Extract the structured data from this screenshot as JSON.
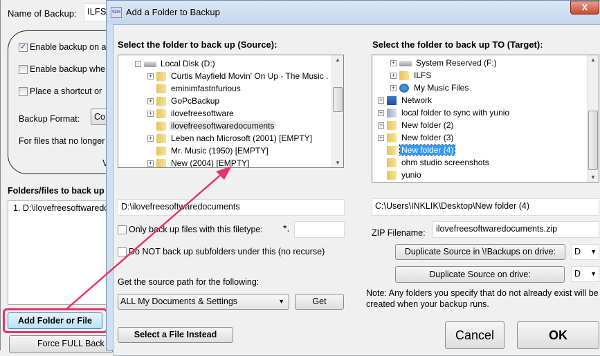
{
  "main_window": {
    "name_label": "Name of Backup:",
    "name_value": "ILFS",
    "options": [
      {
        "label": "Enable backup on a",
        "checked": true
      },
      {
        "label": "Enable backup whe",
        "checked": false
      },
      {
        "label": "Place a shortcut or",
        "checked": false
      }
    ],
    "backup_format_label": "Backup Format:",
    "backup_format_value": "Co",
    "no_longer_label": "For files that no longer",
    "v_label": "V",
    "folders_heading": "Folders/files to back up",
    "folders": [
      "1. D:\\ilovefreesoftwaredo"
    ],
    "add_button": "Add Folder or File",
    "force_button": "Force FULL Back",
    "highlight_color": "#e8336a"
  },
  "dialog": {
    "title": "Add a Folder to Backup",
    "title_icon": "sds-app-icon",
    "close_label": "X",
    "source_heading": "Select the folder to back up (Source):",
    "target_heading": "Select the folder to back up TO (Target):",
    "source_tree": [
      {
        "label": "Local Disk (D:)",
        "icon": "drive-icon",
        "expander": "-",
        "level": 0
      },
      {
        "label": "Curtis Mayfield Movin' On Up - The Music .",
        "icon": "folder-icon",
        "expander": "+",
        "level": 1
      },
      {
        "label": "eminimfastnfurious",
        "icon": "folder-icon",
        "expander": "",
        "level": 1
      },
      {
        "label": "GoPcBackup",
        "icon": "folder-icon",
        "expander": "+",
        "level": 1
      },
      {
        "label": "ilovefreesoftware",
        "icon": "folder-icon",
        "expander": "+",
        "level": 1
      },
      {
        "label": "ilovefreesoftwaredocuments",
        "icon": "folder-icon",
        "expander": "",
        "level": 1,
        "selected": true
      },
      {
        "label": "Leben nach Microsoft (2001) [EMPTY]",
        "icon": "folder-icon",
        "expander": "+",
        "level": 1
      },
      {
        "label": "Mr. Music (1950) [EMPTY]",
        "icon": "folder-icon",
        "expander": "",
        "level": 1
      },
      {
        "label": "New (2004) [EMPTY]",
        "icon": "folder-icon",
        "expander": "+",
        "level": 1
      }
    ],
    "target_tree": [
      {
        "label": "System Reserved (F:)",
        "icon": "drive-icon",
        "expander": "+",
        "level": 1
      },
      {
        "label": "ILFS",
        "icon": "folder-icon",
        "expander": "+",
        "level": 1
      },
      {
        "label": "My Music Files",
        "icon": "music-icon",
        "expander": "+",
        "level": 1
      },
      {
        "label": "Network",
        "icon": "network-icon",
        "expander": "+",
        "level": 0
      },
      {
        "label": "local folder to sync with yunio",
        "icon": "library-icon",
        "expander": "+",
        "level": 0
      },
      {
        "label": "New folder (2)",
        "icon": "folder-icon",
        "expander": "+",
        "level": 0
      },
      {
        "label": "New folder (3)",
        "icon": "folder-icon",
        "expander": "+",
        "level": 0
      },
      {
        "label": "New folder (4)",
        "icon": "folder-icon",
        "expander": "",
        "level": 0,
        "selected": true
      },
      {
        "label": "ohm studio screenshots",
        "icon": "folder-icon",
        "expander": "",
        "level": 0
      },
      {
        "label": "yunio",
        "icon": "folder-icon",
        "expander": "",
        "level": 0
      }
    ],
    "source_path": "D:\\ilovefreesoftwaredocuments",
    "filetype_label": "Only back up files with this filetype:",
    "filetype_prefix": "*.",
    "filetype_value": "",
    "no_recurse_label": "Do NOT back up subfolders under this (no recurse)",
    "get_path_label": "Get the source path for the following:",
    "get_path_option": "ALL My Documents & Settings",
    "get_button": "Get",
    "select_file_button": "Select a File Instead",
    "target_path": "C:\\Users\\INKLIK\\Desktop\\New folder (4)",
    "zip_label": "ZIP Filename:",
    "zip_value": "ilovefreesoftwaredocuments.zip",
    "dup_backups_button": "Duplicate Source in \\!Backups on drive:",
    "dup_backups_drive": "D",
    "dup_drive_button": "Duplicate Source on drive:",
    "dup_drive": "D",
    "note": "Note: Any folders you specify that do not already exist will be created when your backup runs.",
    "cancel_button": "Cancel",
    "ok_button": "OK"
  }
}
